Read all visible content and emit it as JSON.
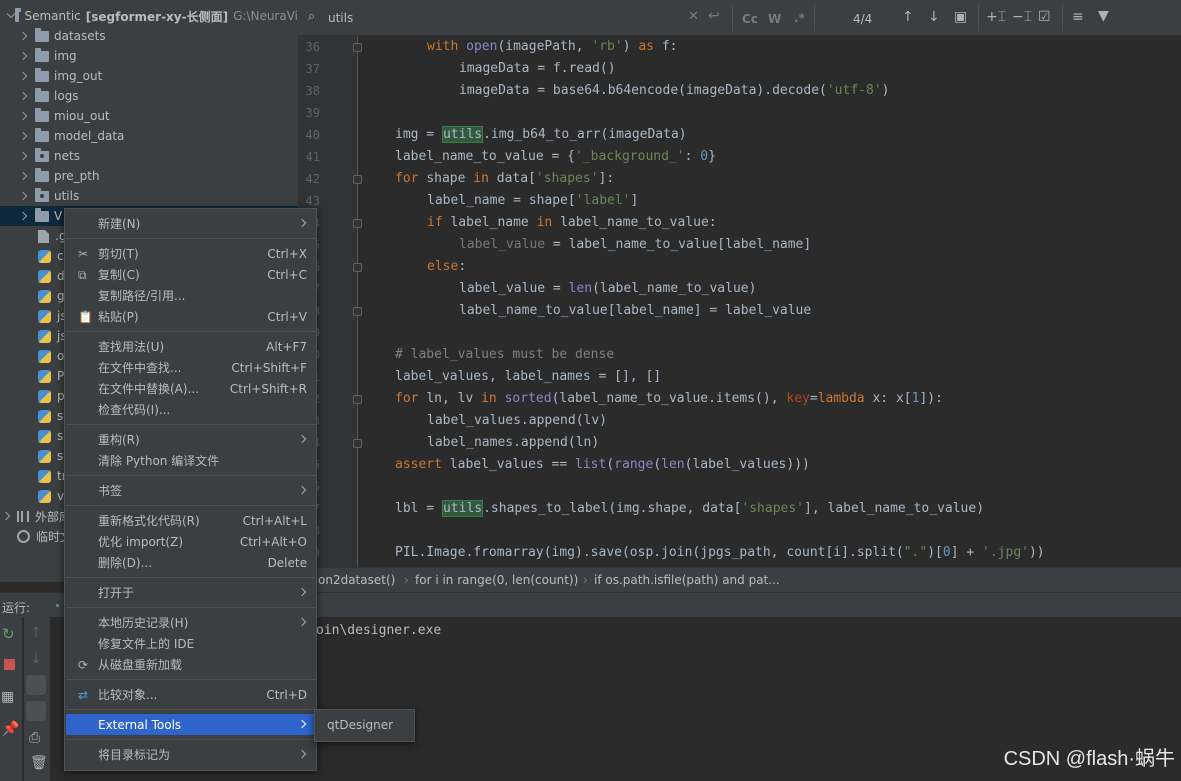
{
  "project": {
    "root_name": "Semantic",
    "root_module": "[segformer-xy-长侧面]",
    "root_path": "G:\\NeuraVi",
    "folders": [
      "datasets",
      "img",
      "img_out",
      "logs",
      "miou_out",
      "model_data",
      "nets",
      "pre_pth",
      "utils",
      "V"
    ],
    "files": [
      ".g",
      "cu",
      "d",
      "g",
      "js",
      "js",
      "o",
      "Pl",
      "p",
      "se",
      "se",
      "su",
      "tr",
      "vo"
    ],
    "external_libs": "外部库",
    "scratches": "临时文件"
  },
  "search": {
    "value": "utils",
    "match_count": "4/4",
    "case_label": "Cc",
    "word_label": "W",
    "regex_label": ".*"
  },
  "editor": {
    "lines": [
      {
        "n": "36",
        "tokens": [
          [
            "kw",
            "with "
          ],
          [
            "bi",
            "open"
          ],
          [
            "",
            "(imagePath, "
          ],
          [
            "st",
            "'rb'"
          ],
          [
            "",
            ") "
          ],
          [
            "kw",
            "as "
          ],
          [
            "",
            "f:"
          ]
        ],
        "indent": 2
      },
      {
        "n": "37",
        "tokens": [
          [
            "",
            "imageData = f.read()"
          ]
        ],
        "indent": 3
      },
      {
        "n": "38",
        "tokens": [
          [
            "",
            "imageData = base64.b64encode(imageData).decode("
          ],
          [
            "st",
            "'utf-8'"
          ],
          [
            "",
            ")"
          ]
        ],
        "indent": 3
      },
      {
        "n": "39",
        "tokens": [],
        "indent": 0
      },
      {
        "n": "40",
        "tokens": [
          [
            "",
            "img = "
          ],
          [
            "hl",
            "utils"
          ],
          [
            "",
            ".img_b64_to_arr(imageData)"
          ]
        ],
        "indent": 1
      },
      {
        "n": "41",
        "tokens": [
          [
            "",
            "label_name_to_value = {"
          ],
          [
            "st",
            "'_background_'"
          ],
          [
            "",
            ": "
          ],
          [
            "nm",
            "0"
          ],
          [
            "",
            "}"
          ]
        ],
        "indent": 1
      },
      {
        "n": "42",
        "tokens": [
          [
            "kw",
            "for "
          ],
          [
            "",
            "shape "
          ],
          [
            "kw",
            "in "
          ],
          [
            "",
            "data["
          ],
          [
            "st",
            "'shapes'"
          ],
          [
            "",
            "]:"
          ]
        ],
        "indent": 1
      },
      {
        "n": "43",
        "tokens": [
          [
            "",
            "label_name = shape["
          ],
          [
            "st",
            "'label'"
          ],
          [
            "",
            "]"
          ]
        ],
        "indent": 2
      },
      {
        "n": "44",
        "tokens": [
          [
            "kw",
            "if "
          ],
          [
            "",
            "label_name "
          ],
          [
            "kw",
            "in "
          ],
          [
            "",
            "label_name_to_value:"
          ]
        ],
        "indent": 2
      },
      {
        "n": "45",
        "tokens": [
          [
            "dim",
            "label_value"
          ],
          [
            "",
            " = label_name_to_value[label_name]"
          ]
        ],
        "indent": 3
      },
      {
        "n": "46",
        "tokens": [
          [
            "kw",
            "else"
          ],
          [
            "",
            ":"
          ]
        ],
        "indent": 2
      },
      {
        "n": "47",
        "tokens": [
          [
            "",
            "label_value = "
          ],
          [
            "bi",
            "len"
          ],
          [
            "",
            "(label_name_to_value)"
          ]
        ],
        "indent": 3
      },
      {
        "n": "48",
        "tokens": [
          [
            "",
            "label_name_to_value[label_name] = label_value"
          ]
        ],
        "indent": 3
      },
      {
        "n": "49",
        "tokens": [],
        "indent": 0
      },
      {
        "n": "50",
        "tokens": [
          [
            "cm",
            "# label_values must be dense"
          ]
        ],
        "indent": 1
      },
      {
        "n": "51",
        "tokens": [
          [
            "",
            "label_values, label_names = [], []"
          ]
        ],
        "indent": 1
      },
      {
        "n": "52",
        "tokens": [
          [
            "kw",
            "for "
          ],
          [
            "",
            "ln, lv "
          ],
          [
            "kw",
            "in "
          ],
          [
            "bi",
            "sorted"
          ],
          [
            "",
            "(label_name_to_value.items(), "
          ],
          [
            "pa",
            "key"
          ],
          [
            "",
            "="
          ],
          [
            "kw",
            "lambda "
          ],
          [
            "",
            "x: x["
          ],
          [
            "nm",
            "1"
          ],
          [
            "",
            "]):"
          ]
        ],
        "indent": 1
      },
      {
        "n": "53",
        "tokens": [
          [
            "",
            "label_values.append(lv)"
          ]
        ],
        "indent": 2
      },
      {
        "n": "54",
        "tokens": [
          [
            "",
            "label_names.append(ln)"
          ]
        ],
        "indent": 2
      },
      {
        "n": "55",
        "tokens": [
          [
            "kw",
            "assert "
          ],
          [
            "",
            "label_values == "
          ],
          [
            "bi",
            "list"
          ],
          [
            "",
            "("
          ],
          [
            "bi",
            "range"
          ],
          [
            "",
            "("
          ],
          [
            "bi",
            "len"
          ],
          [
            "",
            "(label_values)))"
          ]
        ],
        "indent": 1
      },
      {
        "n": "56",
        "tokens": [],
        "indent": 0
      },
      {
        "n": "57",
        "tokens": [
          [
            "",
            "lbl = "
          ],
          [
            "hl",
            "utils"
          ],
          [
            "",
            ".shapes_to_label(img.shape, data["
          ],
          [
            "st",
            "'shapes'"
          ],
          [
            "",
            "], label_name_to_value)"
          ]
        ],
        "indent": 1
      },
      {
        "n": "58",
        "tokens": [],
        "indent": 0
      },
      {
        "n": "59",
        "tokens": [
          [
            "",
            "PIL.Image.fromarray(img).save(osp.join(jpgs_path, count[i].split("
          ],
          [
            "st",
            "\".\""
          ],
          [
            "",
            ")["
          ],
          [
            "nm",
            "0"
          ],
          [
            "",
            "] + "
          ],
          [
            "st",
            "'.jpg'"
          ],
          [
            "",
            "))"
          ]
        ],
        "indent": 1
      }
    ]
  },
  "breadcrumbs": [
    "on2dataset()",
    "for i in range(0, len(count))",
    "if os.path.isfile(path) and pat..."
  ],
  "run": {
    "label": "运行:",
    "output": "oin\\designer.exe"
  },
  "context_menu": {
    "items": [
      {
        "label": "新建(N)",
        "shortcut": "",
        "submenu": true,
        "icon": ""
      },
      {
        "sep": true
      },
      {
        "label": "剪切(T)",
        "shortcut": "Ctrl+X",
        "submenu": false,
        "icon": "scissors-icon"
      },
      {
        "label": "复制(C)",
        "shortcut": "Ctrl+C",
        "submenu": false,
        "icon": "copy-icon"
      },
      {
        "label": "复制路径/引用...",
        "shortcut": "",
        "submenu": false,
        "icon": ""
      },
      {
        "label": "粘贴(P)",
        "shortcut": "Ctrl+V",
        "submenu": false,
        "icon": "clipboard-icon"
      },
      {
        "sep": true
      },
      {
        "label": "查找用法(U)",
        "shortcut": "Alt+F7",
        "submenu": false,
        "icon": ""
      },
      {
        "label": "在文件中查找...",
        "shortcut": "Ctrl+Shift+F",
        "submenu": false,
        "icon": ""
      },
      {
        "label": "在文件中替换(A)...",
        "shortcut": "Ctrl+Shift+R",
        "submenu": false,
        "icon": ""
      },
      {
        "label": "检查代码(I)...",
        "shortcut": "",
        "submenu": false,
        "icon": ""
      },
      {
        "sep": true
      },
      {
        "label": "重构(R)",
        "shortcut": "",
        "submenu": true,
        "icon": ""
      },
      {
        "label": "清除 Python 编译文件",
        "shortcut": "",
        "submenu": false,
        "icon": ""
      },
      {
        "sep": true
      },
      {
        "label": "书签",
        "shortcut": "",
        "submenu": true,
        "icon": ""
      },
      {
        "sep": true
      },
      {
        "label": "重新格式化代码(R)",
        "shortcut": "Ctrl+Alt+L",
        "submenu": false,
        "icon": ""
      },
      {
        "label": "优化 import(Z)",
        "shortcut": "Ctrl+Alt+O",
        "submenu": false,
        "icon": ""
      },
      {
        "label": "删除(D)...",
        "shortcut": "Delete",
        "submenu": false,
        "icon": ""
      },
      {
        "sep": true
      },
      {
        "label": "打开于",
        "shortcut": "",
        "submenu": true,
        "icon": ""
      },
      {
        "sep": true
      },
      {
        "label": "本地历史记录(H)",
        "shortcut": "",
        "submenu": true,
        "icon": ""
      },
      {
        "label": "修复文件上的 IDE",
        "shortcut": "",
        "submenu": false,
        "icon": ""
      },
      {
        "label": "从磁盘重新加载",
        "shortcut": "",
        "submenu": false,
        "icon": "reload-icon"
      },
      {
        "sep": true
      },
      {
        "label": "比较对象...",
        "shortcut": "Ctrl+D",
        "submenu": false,
        "icon": "compare-icon"
      },
      {
        "sep": true
      },
      {
        "label": "External Tools",
        "shortcut": "",
        "submenu": true,
        "icon": "",
        "active": true
      },
      {
        "sep": true
      },
      {
        "label": "将目录标记为",
        "shortcut": "",
        "submenu": true,
        "icon": ""
      }
    ]
  },
  "submenu": {
    "item": "qtDesigner"
  },
  "watermark": "CSDN @flash·蜗牛"
}
